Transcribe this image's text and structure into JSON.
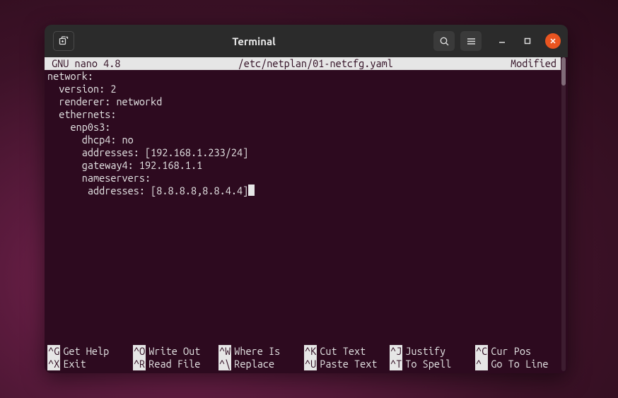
{
  "window": {
    "title": "Terminal"
  },
  "nano": {
    "header_left": "GNU nano 4.8",
    "header_center": "/etc/netplan/01-netcfg.yaml",
    "header_right": "Modified"
  },
  "file_lines": [
    "network:",
    "  version: 2",
    "  renderer: networkd",
    "  ethernets:",
    "    enp0s3:",
    "      dhcp4: no",
    "      addresses: [192.168.1.233/24]",
    "      gateway4: 192.168.1.1",
    "      nameservers:",
    "       addresses: [8.8.8.8,8.8.4.4]"
  ],
  "shortcuts": [
    {
      "key": "^G",
      "label": "Get Help"
    },
    {
      "key": "^X",
      "label": "Exit"
    },
    {
      "key": "^O",
      "label": "Write Out"
    },
    {
      "key": "^R",
      "label": "Read File"
    },
    {
      "key": "^W",
      "label": "Where Is"
    },
    {
      "key": "^\\",
      "label": "Replace"
    },
    {
      "key": "^K",
      "label": "Cut Text"
    },
    {
      "key": "^U",
      "label": "Paste Text"
    },
    {
      "key": "^J",
      "label": "Justify"
    },
    {
      "key": "^T",
      "label": "To Spell"
    },
    {
      "key": "^C",
      "label": "Cur Pos"
    },
    {
      "key": "^ ",
      "label": "Go To Line"
    }
  ]
}
